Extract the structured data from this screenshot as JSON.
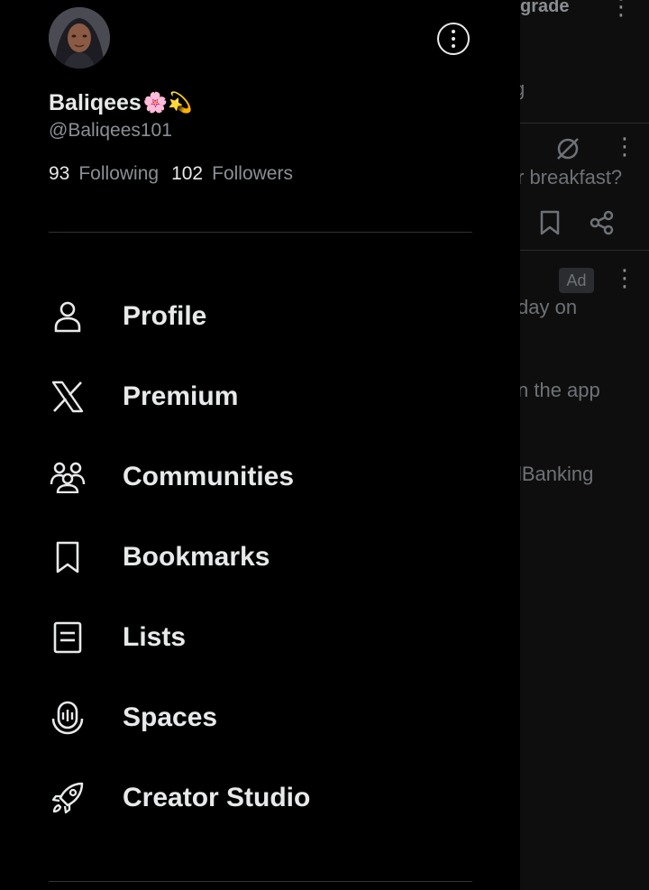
{
  "background": {
    "upgrade_text": "grade",
    "partial_text_1": "g",
    "partial_text_2": "r breakfast?",
    "ad_badge": "Ad",
    "partial_text_3": "day on",
    "partial_text_4": "n the app",
    "partial_text_5": "lBanking"
  },
  "profile": {
    "display_name": "Baliqees",
    "emojis": "🌸💫",
    "handle": "@Baliqees101",
    "following_count": "93",
    "following_label": "Following",
    "followers_count": "102",
    "followers_label": "Followers"
  },
  "menu": [
    {
      "label": "Profile",
      "icon": "person-icon"
    },
    {
      "label": "Premium",
      "icon": "x-logo-icon"
    },
    {
      "label": "Communities",
      "icon": "communities-icon"
    },
    {
      "label": "Bookmarks",
      "icon": "bookmark-icon"
    },
    {
      "label": "Lists",
      "icon": "list-icon"
    },
    {
      "label": "Spaces",
      "icon": "spaces-icon"
    },
    {
      "label": "Creator Studio",
      "icon": "rocket-icon"
    }
  ],
  "colors": {
    "text_primary": "#e7e9ea",
    "text_secondary": "#8b8f94",
    "background": "#000000",
    "divider": "#2f3336"
  }
}
